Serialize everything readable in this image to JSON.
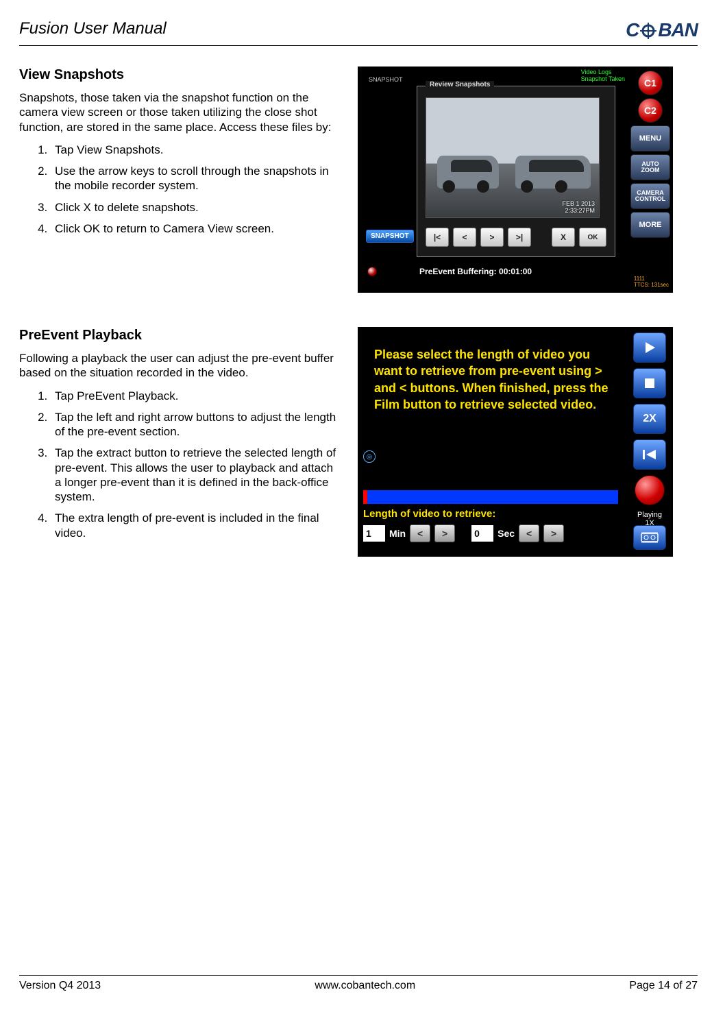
{
  "header": {
    "doc_title": "Fusion User Manual",
    "brand_text": "COBAN",
    "brand_letters": [
      "C",
      "BAN"
    ]
  },
  "section1": {
    "heading": "View Snapshots",
    "intro": "Snapshots, those taken via the snapshot function on the camera view screen or those taken utilizing the close shot function, are stored in the same place. Access these files by:",
    "steps": [
      "Tap View Snapshots.",
      "Use the arrow keys to scroll through the snapshots in the mobile recorder system.",
      "Click X to delete snapshots.",
      "Click OK to return to Camera View screen."
    ],
    "shot": {
      "top_labels": "Video Logs\nSnapshot Taken",
      "reticle": "SNAPSHOT",
      "review_title": "Review Snapshots",
      "snapshot_btn": "SNAPSHOT",
      "c_letter": "C",
      "thumb_date": "FEB   1 2013",
      "thumb_time": "2:33:27PM",
      "nav": {
        "first": "|<",
        "prev": "<",
        "next": ">",
        "last": ">|",
        "delete": "X",
        "ok": "OK"
      },
      "buffer": "PreEvent Buffering: 00:01:00",
      "side": {
        "c1": "C1",
        "c2": "C2",
        "menu": "MENU",
        "autozoom": "AUTO\nZOOM",
        "camctrl": "CAMERA\nCONTROL",
        "more": "MORE"
      },
      "corner": "1111\nTTCS: 131sec"
    }
  },
  "section2": {
    "heading": "PreEvent Playback",
    "intro": "Following a playback the user can adjust the pre-event buffer based on the situation recorded in the video.",
    "steps": [
      "Tap PreEvent Playback.",
      "Tap the left and right arrow buttons to adjust the length of the pre-event section.",
      "Tap the extract button to retrieve the selected length of pre-event. This allows the user to playback and attach a longer pre-event than it is defined in the back-office system.",
      "The extra length of pre-event is included in the final video."
    ],
    "shot": {
      "msg": "Please select the length of video you want to retrieve from pre-event using > and < buttons. When finished, press the Film button to retrieve selected video.",
      "retrieve_label": "Length of video to retrieve:",
      "min_val": "1",
      "min_unit": "Min",
      "sec_val": "0",
      "sec_unit": "Sec",
      "r": {
        "play": "▶",
        "stop": "■",
        "speed": "2X",
        "rewind": "|◀",
        "playing": "Playing\n1X"
      }
    }
  },
  "footer": {
    "version": "Version Q4 2013",
    "url": "www.cobantech.com",
    "page": "Page 14 of 27"
  }
}
